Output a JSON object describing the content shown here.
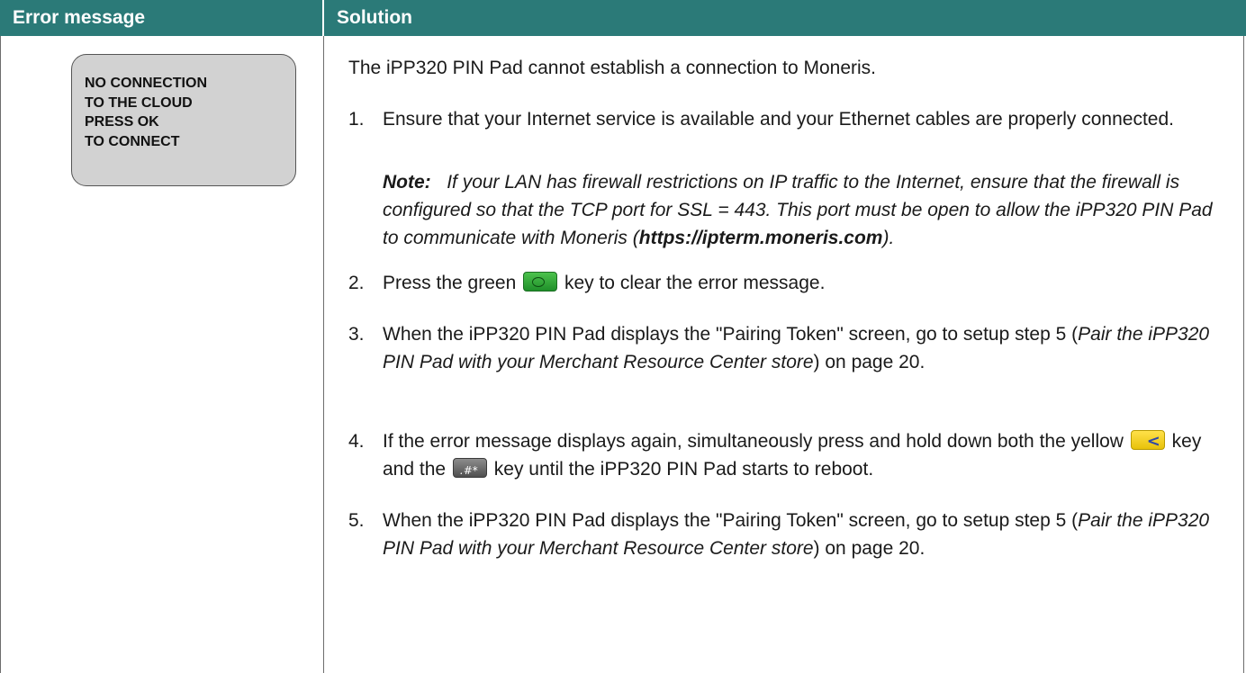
{
  "header": {
    "error_col": "Error message",
    "solution_col": "Solution"
  },
  "screen_lines": [
    "NO CONNECTION",
    "TO THE CLOUD",
    "PRESS OK",
    "TO CONNECT"
  ],
  "solution": {
    "intro": "The iPP320 PIN Pad cannot establish a connection to Moneris.",
    "step1": {
      "num": "1.",
      "text": "Ensure that your Internet service is available and your Ethernet cables are properly connected."
    },
    "note": {
      "label": "Note:",
      "text": "If your LAN has firewall restrictions on IP traffic to the Internet, ensure that the firewall is configured so that the TCP port for SSL = 443.  This port must be open to allow the iPP320 PIN Pad to communicate with Moneris (",
      "url": "https://ipterm.moneris.com",
      "end": ")."
    },
    "step2": {
      "num": "2.",
      "before": "Press the green",
      "after": "key to clear the error message."
    },
    "step3": {
      "num": "3.",
      "before": "When the iPP320 PIN Pad displays the \"Pairing Token\" screen, go to setup step 5 (",
      "italic": "Pair the iPP320 PIN Pad with your Merchant Resource Center store",
      "after": ") on page 20."
    },
    "step4": {
      "num": "4.",
      "before": "If the error message displays again, simultaneously press and hold down both the yellow",
      "middle": "key and the",
      "after": "key until the iPP320 PIN Pad starts to reboot."
    },
    "step5": {
      "num": "5.",
      "before": "When the iPP320 PIN Pad displays the \"Pairing Token\" screen, go to setup step 5 (",
      "italic": "Pair the iPP320 PIN Pad with your Merchant Resource Center store",
      "after": ") on page 20."
    }
  },
  "colors": {
    "header_bg": "#2b7a78",
    "screen_bg": "#d2d2d2",
    "green_key": "#2fa83a",
    "yellow_key": "#f2d21e",
    "grey_key": "#666666"
  },
  "icons": [
    "green-enter-key-icon",
    "yellow-clear-key-icon",
    "dot-hash-star-key-icon"
  ]
}
